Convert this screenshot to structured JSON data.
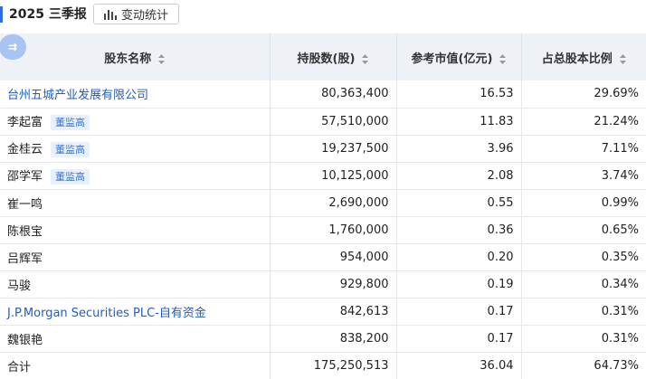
{
  "header": {
    "period": "2025 三季报",
    "change_button": "变动统计",
    "change_icon": "bar-chart-icon"
  },
  "corner_icon": {
    "name": "collapse-icon",
    "glyph": "⇉"
  },
  "columns": [
    "股东名称",
    "持股数(股)",
    "参考市值(亿元)",
    "占总股本比例"
  ],
  "rows": [
    {
      "name": "台州五城产业发展有限公司",
      "shares": "80,363,400",
      "value": "16.53",
      "ratio": "29.69%",
      "link": true,
      "tag": ""
    },
    {
      "name": "李起富",
      "shares": "57,510,000",
      "value": "11.83",
      "ratio": "21.24%",
      "link": false,
      "tag": "董监高"
    },
    {
      "name": "金桂云",
      "shares": "19,237,500",
      "value": "3.96",
      "ratio": "7.11%",
      "link": false,
      "tag": "董监高"
    },
    {
      "name": "邵学军",
      "shares": "10,125,000",
      "value": "2.08",
      "ratio": "3.74%",
      "link": false,
      "tag": "董监高"
    },
    {
      "name": "崔一鸣",
      "shares": "2,690,000",
      "value": "0.55",
      "ratio": "0.99%",
      "link": false,
      "tag": ""
    },
    {
      "name": "陈根宝",
      "shares": "1,760,000",
      "value": "0.36",
      "ratio": "0.65%",
      "link": false,
      "tag": ""
    },
    {
      "name": "吕辉军",
      "shares": "954,000",
      "value": "0.20",
      "ratio": "0.35%",
      "link": false,
      "tag": ""
    },
    {
      "name": "马骏",
      "shares": "929,800",
      "value": "0.19",
      "ratio": "0.34%",
      "link": false,
      "tag": ""
    },
    {
      "name": "J.P.Morgan Securities PLC-自有资金",
      "shares": "842,613",
      "value": "0.17",
      "ratio": "0.31%",
      "link": true,
      "tag": ""
    },
    {
      "name": "魏银艳",
      "shares": "838,200",
      "value": "0.17",
      "ratio": "0.31%",
      "link": false,
      "tag": ""
    }
  ],
  "total": {
    "label": "合计",
    "shares": "175,250,513",
    "value": "36.04",
    "ratio": "64.73%"
  },
  "colors": {
    "accent": "#2b6de8",
    "link": "#1f5cc5",
    "header_bg": "#eef1f6",
    "tag_bg": "#e8f0fc"
  }
}
